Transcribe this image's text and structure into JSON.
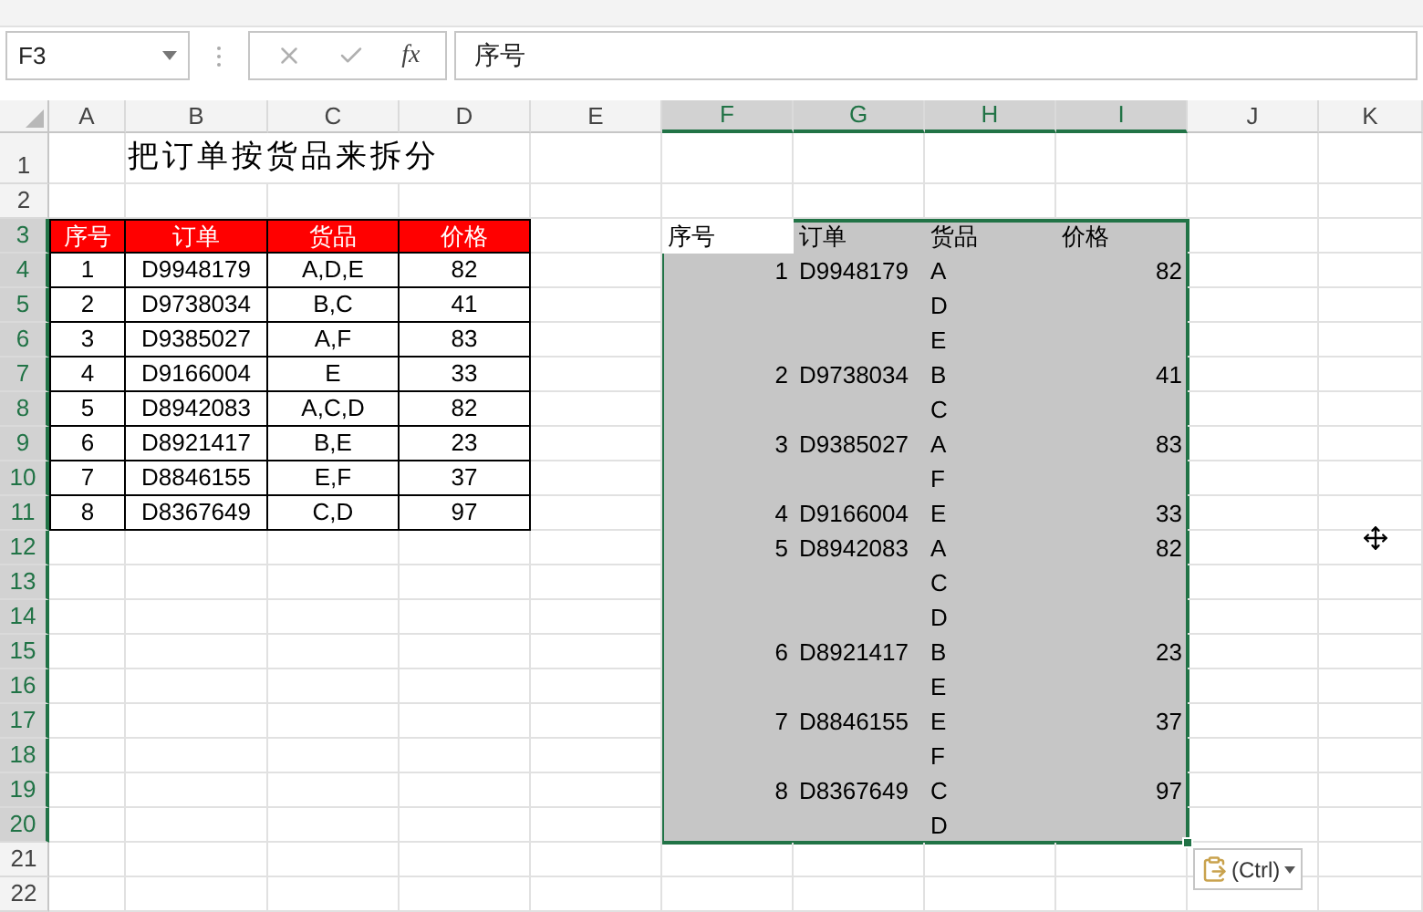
{
  "formula_bar": {
    "name_box": "F3",
    "function_label": "fx",
    "formula": "序号"
  },
  "columns": [
    {
      "label": "A",
      "selected": false
    },
    {
      "label": "B",
      "selected": false
    },
    {
      "label": "C",
      "selected": false
    },
    {
      "label": "D",
      "selected": false
    },
    {
      "label": "E",
      "selected": false
    },
    {
      "label": "F",
      "selected": true
    },
    {
      "label": "G",
      "selected": true
    },
    {
      "label": "H",
      "selected": true
    },
    {
      "label": "I",
      "selected": true
    },
    {
      "label": "J",
      "selected": false
    },
    {
      "label": "K",
      "selected": false
    }
  ],
  "row_numbers": [
    {
      "label": "1",
      "selected": false
    },
    {
      "label": "2",
      "selected": false
    },
    {
      "label": "3",
      "selected": true
    },
    {
      "label": "4",
      "selected": true
    },
    {
      "label": "5",
      "selected": true
    },
    {
      "label": "6",
      "selected": true
    },
    {
      "label": "7",
      "selected": true
    },
    {
      "label": "8",
      "selected": true
    },
    {
      "label": "9",
      "selected": true
    },
    {
      "label": "10",
      "selected": true
    },
    {
      "label": "11",
      "selected": true
    },
    {
      "label": "12",
      "selected": true
    },
    {
      "label": "13",
      "selected": true
    },
    {
      "label": "14",
      "selected": true
    },
    {
      "label": "15",
      "selected": true
    },
    {
      "label": "16",
      "selected": true
    },
    {
      "label": "17",
      "selected": true
    },
    {
      "label": "18",
      "selected": true
    },
    {
      "label": "19",
      "selected": true
    },
    {
      "label": "20",
      "selected": true
    },
    {
      "label": "21",
      "selected": false
    },
    {
      "label": "22",
      "selected": false
    }
  ],
  "title": "把订单按货品来拆分",
  "source_table": {
    "columns": [
      "序号",
      "订单",
      "货品",
      "价格"
    ],
    "rows": [
      [
        "1",
        "D9948179",
        "A,D,E",
        "82"
      ],
      [
        "2",
        "D9738034",
        "B,C",
        "41"
      ],
      [
        "3",
        "D9385027",
        "A,F",
        "83"
      ],
      [
        "4",
        "D9166004",
        "E",
        "33"
      ],
      [
        "5",
        "D8942083",
        "A,C,D",
        "82"
      ],
      [
        "6",
        "D8921417",
        "B,E",
        "23"
      ],
      [
        "7",
        "D8846155",
        "E,F",
        "37"
      ],
      [
        "8",
        "D8367649",
        "C,D",
        "97"
      ]
    ]
  },
  "result_table": {
    "columns": [
      "序号",
      "订单",
      "货品",
      "价格"
    ],
    "rows": [
      {
        "F": "1",
        "G": "D9948179",
        "H": "A",
        "I": "82"
      },
      {
        "H": "D"
      },
      {
        "H": "E"
      },
      {
        "F": "2",
        "G": "D9738034",
        "H": "B",
        "I": "41"
      },
      {
        "H": "C"
      },
      {
        "F": "3",
        "G": "D9385027",
        "H": "A",
        "I": "83"
      },
      {
        "H": "F"
      },
      {
        "F": "4",
        "G": "D9166004",
        "H": "E",
        "I": "33"
      },
      {
        "F": "5",
        "G": "D8942083",
        "H": "A",
        "I": "82"
      },
      {
        "H": "C"
      },
      {
        "H": "D"
      },
      {
        "F": "6",
        "G": "D8921417",
        "H": "B",
        "I": "23"
      },
      {
        "H": "E"
      },
      {
        "F": "7",
        "G": "D8846155",
        "H": "E",
        "I": "37"
      },
      {
        "H": "F"
      },
      {
        "F": "8",
        "G": "D8367649",
        "H": "C",
        "I": "97"
      },
      {
        "H": "D"
      }
    ]
  },
  "paste_options": {
    "label": "(Ctrl)"
  }
}
